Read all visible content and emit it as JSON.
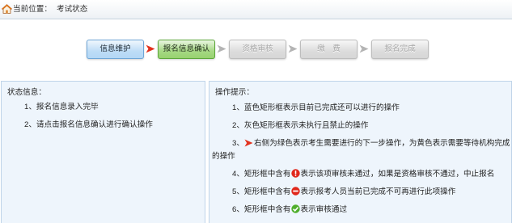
{
  "header": {
    "icon": "home-icon",
    "location_label": "当前位置：",
    "location_value": "考试状态"
  },
  "steps": [
    {
      "label": "信息维护",
      "color": "#b3d7f5",
      "border": "#6ea6d8",
      "text_color": "#1e2a36"
    },
    {
      "label": "报名信息确认",
      "color": "#97d26f",
      "border": "#5ea83c",
      "text_color": "#1e2a18"
    },
    {
      "label": "资格审核",
      "color": "#d6d6d6",
      "border": "#bdbdbd",
      "text_color": "#a6a6a6"
    },
    {
      "label": "缴　费",
      "color": "#d6d6d6",
      "border": "#bdbdbd",
      "text_color": "#a6a6a6"
    },
    {
      "label": "报名完成",
      "color": "#d6d6d6",
      "border": "#bdbdbd",
      "text_color": "#a6a6a6"
    }
  ],
  "connectors": [
    {
      "icon": "arrow-right-icon",
      "color": "#e2321e"
    },
    {
      "icon": "arrow-right-icon",
      "color": "#b4b4b4"
    },
    {
      "icon": "arrow-right-icon",
      "color": "#b4b4b4"
    },
    {
      "icon": "arrow-right-icon",
      "color": "#b4b4b4"
    }
  ],
  "status_panel": {
    "title": "状态信息：",
    "items": [
      {
        "text": "1、报名信息录入完毕"
      },
      {
        "text": "2、请点击报名信息确认进行确认操作"
      }
    ]
  },
  "tips_panel": {
    "title": "操作提示：",
    "items": [
      {
        "text": "1、蓝色矩形框表示目前已完成还可以进行的操作"
      },
      {
        "text": "2、灰色矩形框表示未执行且禁止的操作"
      },
      {
        "before": "3、",
        "icon": "red-arrow-icon",
        "after": "右侧为绿色表示考生需要进行的下一步操作，为黄色表示需要等待机构完成的操作"
      },
      {
        "before": "4、矩形框中含有",
        "icon": "red-exclamation-icon",
        "after": "表示该项审核未通过，如果是资格审核不通过，中止报名"
      },
      {
        "before": "5、矩形框中含有",
        "icon": "red-minus-icon",
        "after": "表示报考人员当前已完成不可再进行此项操作"
      },
      {
        "before": "6、矩形框中含有",
        "icon": "green-check-icon",
        "after": "表示审核通过"
      }
    ]
  },
  "colors": {
    "panel_background": "#eef5fc",
    "panel_border": "#bfd4e9",
    "error_red": "#e0281c",
    "success_green": "#4fae2c"
  }
}
